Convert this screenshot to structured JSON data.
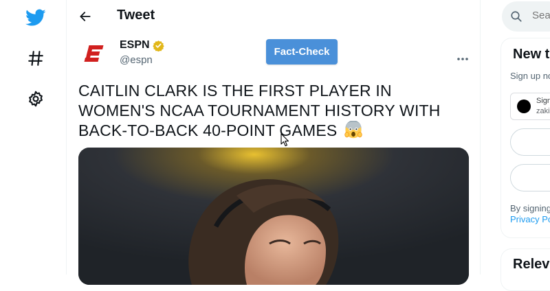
{
  "header": {
    "title": "Tweet"
  },
  "tweet": {
    "author_name": "ESPN",
    "author_handle": "@espn",
    "text": "CAITLIN CLARK IS THE FIRST PLAYER IN WOMEN'S NCAA TOURNAMENT HISTORY WITH BACK-TO-BACK 40-POINT GAMES",
    "emoji": "face-screaming-in-fear",
    "verified_color": "#e2b719",
    "media_alt": "photo"
  },
  "extension": {
    "fact_check_label": "Fact-Check",
    "accent": "#4a90d9"
  },
  "nav": {
    "items": [
      {
        "icon": "twitter-bird-icon",
        "color": "#1d9bf0"
      },
      {
        "icon": "hashtag-icon"
      },
      {
        "icon": "gear-icon"
      }
    ]
  },
  "sidebar": {
    "search_placeholder": "Sea",
    "new_card_title": "New t",
    "signup_text": "Sign up no",
    "google_label": "Sign",
    "google_sub": "zaki",
    "terms_text": "By signing",
    "terms_link": "Privacy Po",
    "relevant_title": "Relev"
  }
}
